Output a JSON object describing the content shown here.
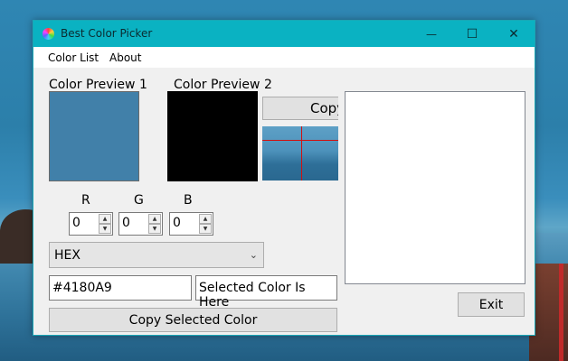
{
  "window": {
    "title": "Best Color Picker",
    "controls": {
      "minimize": "—",
      "maximize": "☐",
      "close": "✕"
    }
  },
  "menu": {
    "items": [
      "Color List",
      "About"
    ]
  },
  "preview": {
    "label1": "Color Preview 1",
    "label2": "Color Preview 2",
    "color1": "#4180A9",
    "color2": "#000000",
    "copy_button": "Copy"
  },
  "rgb": {
    "labels": [
      "R",
      "G",
      "B"
    ],
    "values": [
      "0",
      "0",
      "0"
    ]
  },
  "format_select": {
    "selected": "HEX"
  },
  "hex_field": {
    "value": "#4180A9"
  },
  "selected_color_field": {
    "value": "Selected Color Is Here"
  },
  "copy_selected_button": "Copy Selected Color",
  "exit_button": "Exit"
}
